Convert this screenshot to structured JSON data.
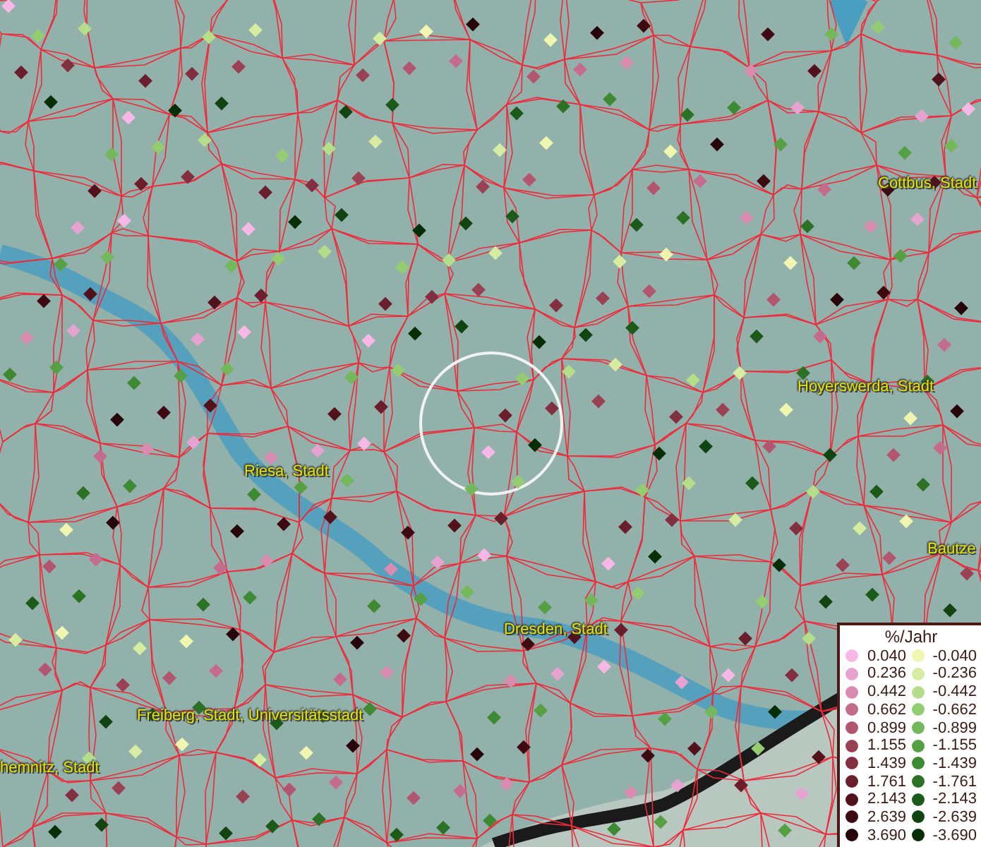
{
  "map": {
    "place_labels": [
      {
        "text": "Cottbus, Stadt"
      },
      {
        "text": "Hoyerswerda, Stadt"
      },
      {
        "text": "Riesa, Stadt"
      },
      {
        "text": "Bautze"
      },
      {
        "text": "Dresden, Stadt"
      },
      {
        "text": "Freiberg, Stadt, Universitätsstadt"
      },
      {
        "text": "hemnitz, Stadt"
      }
    ]
  },
  "legend": {
    "title": "%/Jahr",
    "columns": [
      {
        "entries": [
          {
            "value": "0.040",
            "color": "#f7b8e6"
          },
          {
            "value": "0.236",
            "color": "#e6a3cf"
          },
          {
            "value": "0.442",
            "color": "#d98bb0"
          },
          {
            "value": "0.662",
            "color": "#c56b8c"
          },
          {
            "value": "0.899",
            "color": "#b25670"
          },
          {
            "value": "1.155",
            "color": "#9a4153"
          },
          {
            "value": "1.439",
            "color": "#822f40"
          },
          {
            "value": "1.761",
            "color": "#6b1e2c"
          },
          {
            "value": "2.143",
            "color": "#52121c"
          },
          {
            "value": "2.639",
            "color": "#3d0a12"
          },
          {
            "value": "3.690",
            "color": "#26040a"
          }
        ]
      },
      {
        "entries": [
          {
            "value": "-0.040",
            "color": "#f0f5b0"
          },
          {
            "value": "-0.236",
            "color": "#d6eca0"
          },
          {
            "value": "-0.442",
            "color": "#b6dd8a"
          },
          {
            "value": "-0.662",
            "color": "#94cc72"
          },
          {
            "value": "-0.899",
            "color": "#74b85c"
          },
          {
            "value": "-1.155",
            "color": "#55a043"
          },
          {
            "value": "-1.439",
            "color": "#3e8a33"
          },
          {
            "value": "-1.761",
            "color": "#2c7226"
          },
          {
            "value": "-2.143",
            "color": "#1c5a1a"
          },
          {
            "value": "-2.639",
            "color": "#104410"
          },
          {
            "value": "-3.690",
            "color": "#052e07"
          }
        ]
      }
    ]
  }
}
